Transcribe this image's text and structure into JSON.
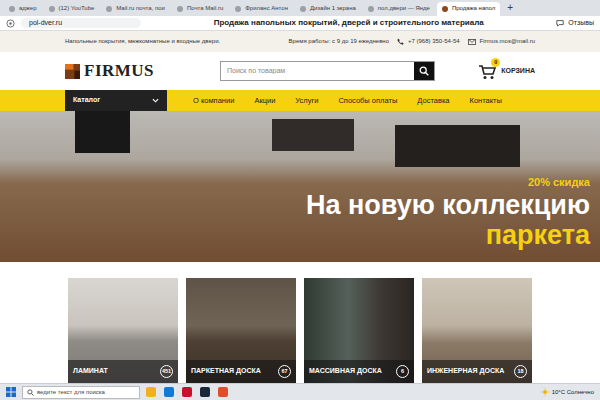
{
  "browser": {
    "tabs": [
      {
        "label": "аджер",
        "selected": false
      },
      {
        "label": "(12) YouTube",
        "selected": false
      },
      {
        "label": "Mail.ru почта, пои",
        "selected": false
      },
      {
        "label": "Почта Mail.ru",
        "selected": false
      },
      {
        "label": "Фриланс Антон",
        "selected": false
      },
      {
        "label": "Дизайн 1 экрана",
        "selected": false
      },
      {
        "label": "пол.двери — Янде",
        "selected": false
      },
      {
        "label": "Продажа напол",
        "selected": true
      }
    ],
    "new_tab": "+",
    "address": "pol-dver.ru",
    "page_title": "Продажа напольных покрытий, дверей и строительного материала",
    "reviews": "Отзывы"
  },
  "site": {
    "topbar": {
      "tagline": "Напольные покрытия, межкомнатные и входные двери.",
      "hours": "Время работы: с 9 до 19 ежедневно",
      "phone": "+7 (968) 350-54-54",
      "email": "Firmus.mos@mail.ru"
    },
    "logo": "FIRMUS",
    "search": {
      "placeholder": "Поиск по товарам"
    },
    "cart": {
      "label": "КОРЗИНА",
      "count": "0"
    },
    "nav": {
      "catalog": "Каталог",
      "items": [
        "О компании",
        "Акции",
        "Услуги",
        "Способы оплаты",
        "Доставка",
        "Контакты"
      ]
    },
    "hero": {
      "discount": "20% скидка",
      "line1": "На новую коллекцию",
      "line2": "паркета"
    },
    "categories": [
      {
        "name": "ЛАМИНАТ",
        "count": "451"
      },
      {
        "name": "ПАРКЕТНАЯ ДОСКА",
        "count": "67"
      },
      {
        "name": "МАССИВНАЯ ДОСКА",
        "count": "6"
      },
      {
        "name": "ИНЖЕНЕРНАЯ ДОСКА",
        "count": "18"
      }
    ]
  },
  "taskbar": {
    "search": "ведите текст для поиска",
    "weather": "10°C Солнечно"
  }
}
